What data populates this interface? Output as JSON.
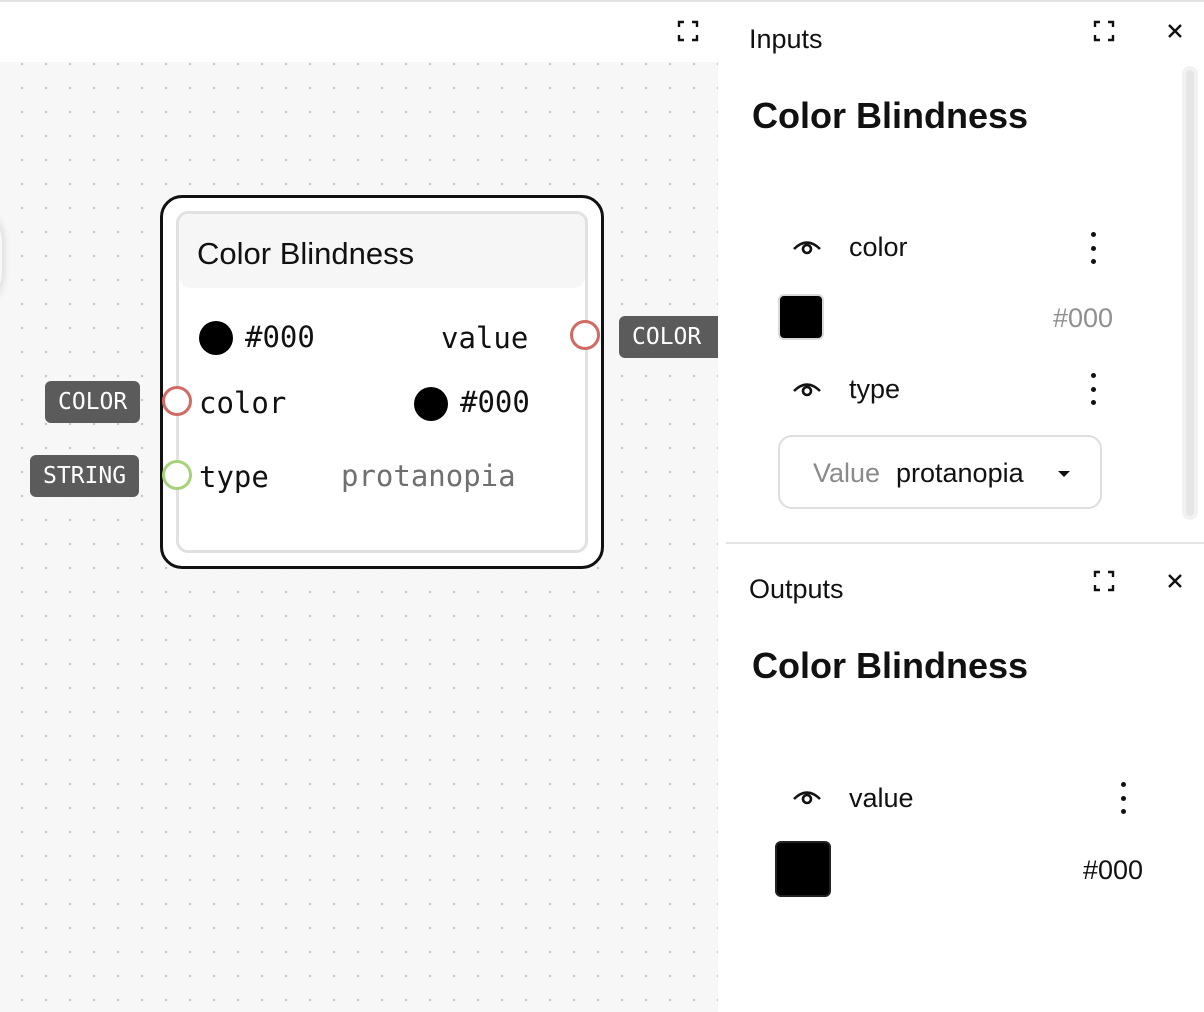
{
  "node": {
    "title": "Color Blindness",
    "out_value": "#000",
    "out_label": "value",
    "out_type": "COLOR",
    "in_color_label": "color",
    "in_color_value": "#000",
    "in_color_type": "COLOR",
    "in_type_label": "type",
    "in_type_value": "protanopia",
    "in_type_type": "STRING"
  },
  "inputs_panel": {
    "header": "Inputs",
    "title": "Color Blindness",
    "color_label": "color",
    "color_value": "#000",
    "type_label": "type",
    "type_select_label": "Value",
    "type_select_value": "protanopia"
  },
  "outputs_panel": {
    "header": "Outputs",
    "title": "Color Blindness",
    "value_label": "value",
    "value_hex": "#000"
  },
  "colors": {
    "port_color": "#d06a62",
    "port_string": "#a6d27a",
    "tag_bg": "#5b5b5b",
    "swatch": "#000000"
  },
  "icons": [
    "fullscreen-icon",
    "close-icon",
    "eye-icon",
    "kebab-menu-icon",
    "caret-down-icon"
  ]
}
